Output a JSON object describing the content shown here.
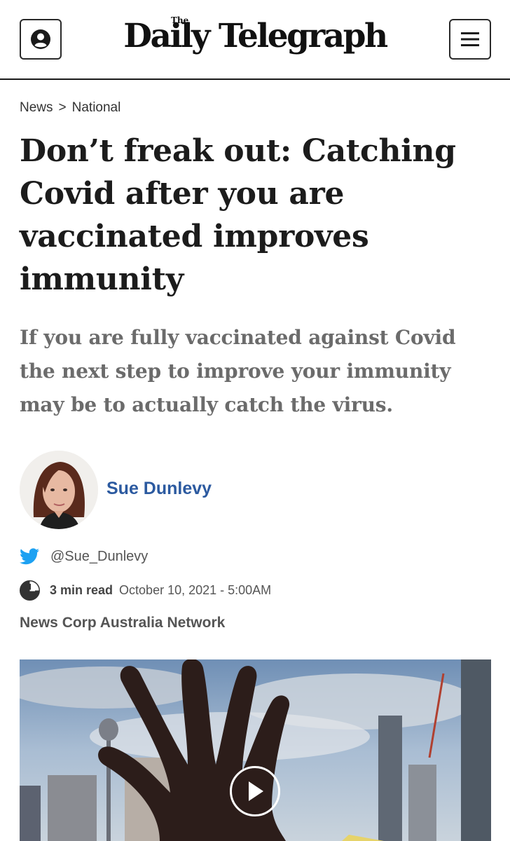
{
  "header": {
    "masthead_small": "The",
    "masthead": "Daily Telegraph",
    "account_icon": "user-icon",
    "menu_icon": "hamburger-icon"
  },
  "breadcrumb": {
    "items": [
      "News",
      "National"
    ],
    "separator": ">"
  },
  "article": {
    "headline": "Don’t freak out: Catching Covid after you are vaccinated improves immunity",
    "standfirst": "If you are fully vaccinated against Covid the next step to improve your immunity may be to actually catch the virus.",
    "author": {
      "name": "Sue Dunlevy",
      "twitter_handle": "@Sue_Dunlevy"
    },
    "read_time": "3 min read",
    "date": "October 10, 2021 - 5:00AM",
    "network": "News Corp Australia Network"
  },
  "colors": {
    "link_blue": "#2c5aa0",
    "twitter_blue": "#1da1f2",
    "standfirst_grey": "#6b6b6b"
  },
  "media": {
    "play_icon": "play-icon"
  }
}
